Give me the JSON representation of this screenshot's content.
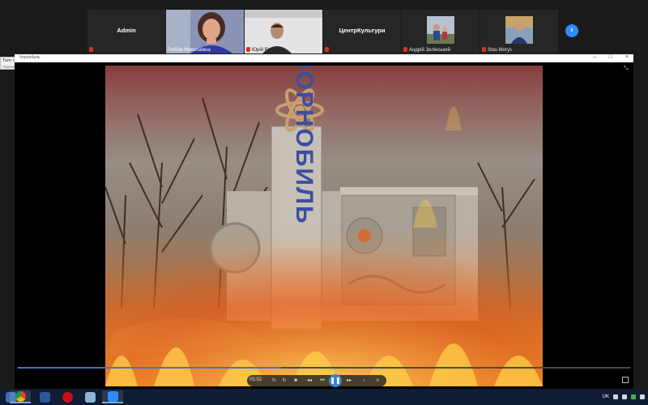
{
  "participants": [
    {
      "name": "Admin",
      "has_video": false
    },
    {
      "name": "Любов Миколаївна",
      "has_video": true
    },
    {
      "name": "Юрій Волошин",
      "has_video": true
    },
    {
      "name": "ЦентрКультури",
      "has_video": false
    },
    {
      "name": "Андрій Зелінський",
      "has_video": false
    },
    {
      "name": "Stas Morys",
      "has_video": false
    }
  ],
  "player": {
    "title": "Чорнобиль",
    "tooltip_title": "Turn on Original Sound",
    "tooltip_sub": "Чорнобиль",
    "time": "05:52",
    "progress": 0.43,
    "video_text": "ЧОРНОБИЛЬ"
  },
  "taskbar": {
    "language": "UK"
  },
  "colors": {
    "zoom_blue": "#2d8cff",
    "mic_muted": "#d93025",
    "play_blue": "#3b84d4",
    "taskbar": "#0f1c33"
  },
  "icons": [
    "chevron-right-icon",
    "mic-muted-icon",
    "play-pause-icon",
    "volume-icon",
    "fullscreen-icon",
    "expand-icon"
  ]
}
